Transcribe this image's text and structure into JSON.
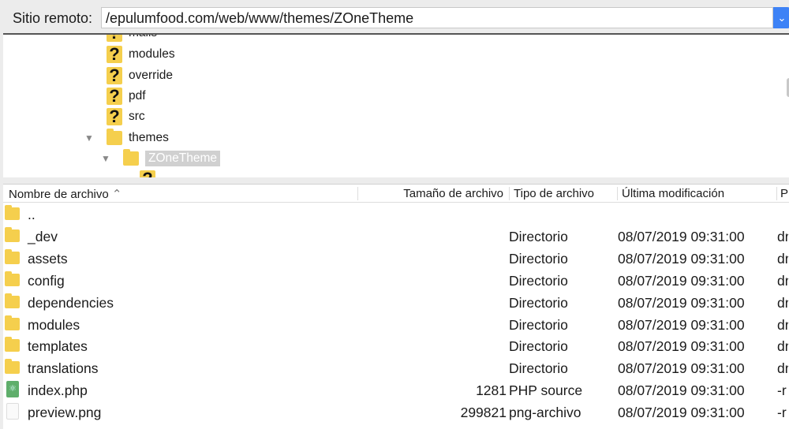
{
  "path_bar": {
    "label": "Sitio remoto:",
    "value": "/epulumfood.com/web/www/themes/ZOneTheme"
  },
  "tree": [
    {
      "label": "mails",
      "icon": "unknown-folder-icon"
    },
    {
      "label": "modules",
      "icon": "unknown-folder-icon"
    },
    {
      "label": "override",
      "icon": "unknown-folder-icon"
    },
    {
      "label": "pdf",
      "icon": "unknown-folder-icon"
    },
    {
      "label": "src",
      "icon": "unknown-folder-icon"
    },
    {
      "label": "themes",
      "icon": "folder-icon",
      "expanded": true
    },
    {
      "label": "ZOneTheme",
      "icon": "open-folder-icon",
      "expanded": true,
      "selected": true
    }
  ],
  "columns": {
    "name": "Nombre de archivo",
    "size": "Tamaño de archivo",
    "type": "Tipo de archivo",
    "modified": "Última modificación",
    "perms": "P"
  },
  "files": [
    {
      "name": "..",
      "size": "",
      "type": "",
      "modified": "",
      "perms": "",
      "icon": "folder"
    },
    {
      "name": "_dev",
      "size": "",
      "type": "Directorio",
      "modified": "08/07/2019 09:31:00",
      "perms": "dr",
      "icon": "folder"
    },
    {
      "name": "assets",
      "size": "",
      "type": "Directorio",
      "modified": "08/07/2019 09:31:00",
      "perms": "dr",
      "icon": "folder"
    },
    {
      "name": "config",
      "size": "",
      "type": "Directorio",
      "modified": "08/07/2019 09:31:00",
      "perms": "dr",
      "icon": "folder"
    },
    {
      "name": "dependencies",
      "size": "",
      "type": "Directorio",
      "modified": "08/07/2019 09:31:00",
      "perms": "dr",
      "icon": "folder"
    },
    {
      "name": "modules",
      "size": "",
      "type": "Directorio",
      "modified": "08/07/2019 09:31:00",
      "perms": "dr",
      "icon": "folder"
    },
    {
      "name": "templates",
      "size": "",
      "type": "Directorio",
      "modified": "08/07/2019 09:31:00",
      "perms": "dr",
      "icon": "folder"
    },
    {
      "name": "translations",
      "size": "",
      "type": "Directorio",
      "modified": "08/07/2019 09:31:00",
      "perms": "dr",
      "icon": "folder"
    },
    {
      "name": "index.php",
      "size": "1281",
      "type": "PHP source",
      "modified": "08/07/2019 09:31:00",
      "perms": "-r",
      "icon": "php"
    },
    {
      "name": "preview.png",
      "size": "299821",
      "type": "png-archivo",
      "modified": "08/07/2019 09:31:00",
      "perms": "-r",
      "icon": "png"
    }
  ]
}
